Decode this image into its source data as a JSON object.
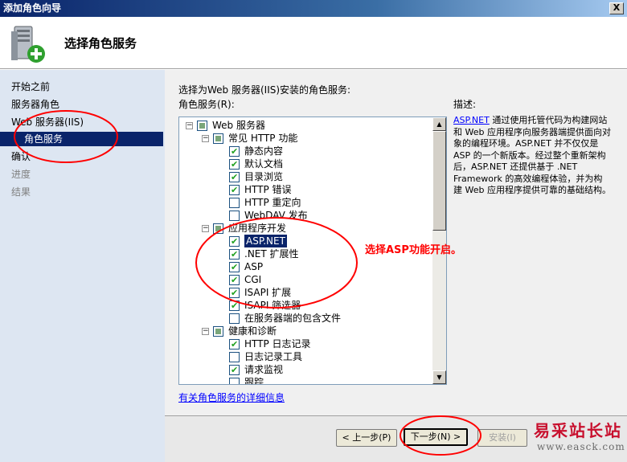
{
  "window": {
    "title": "添加角色向导",
    "close_glyph": "X"
  },
  "header": {
    "heading": "选择角色服务",
    "icon": "server-add-role-icon"
  },
  "sidebar": {
    "items": [
      {
        "label": "开始之前",
        "state": "normal"
      },
      {
        "label": "服务器角色",
        "state": "normal"
      },
      {
        "label": "Web 服务器(IIS)",
        "state": "normal"
      },
      {
        "label": "角色服务",
        "state": "active"
      },
      {
        "label": "确认",
        "state": "normal"
      },
      {
        "label": "进度",
        "state": "disabled"
      },
      {
        "label": "结果",
        "state": "disabled"
      }
    ]
  },
  "main": {
    "instruction": "选择为Web 服务器(IIS)安装的角色服务:",
    "list_label": "角色服务(R):",
    "tree": [
      {
        "label": "Web 服务器",
        "level": 0,
        "expander": "minus",
        "check": "partial"
      },
      {
        "label": "常见 HTTP 功能",
        "level": 1,
        "expander": "minus",
        "check": "partial"
      },
      {
        "label": "静态内容",
        "level": 2,
        "check": "checked"
      },
      {
        "label": "默认文档",
        "level": 2,
        "check": "checked"
      },
      {
        "label": "目录浏览",
        "level": 2,
        "check": "checked"
      },
      {
        "label": "HTTP 错误",
        "level": 2,
        "check": "checked"
      },
      {
        "label": "HTTP 重定向",
        "level": 2,
        "check": "unchecked"
      },
      {
        "label": "WebDAV 发布",
        "level": 2,
        "check": "unchecked"
      },
      {
        "label": "应用程序开发",
        "level": 1,
        "expander": "minus",
        "check": "partial"
      },
      {
        "label": "ASP.NET",
        "level": 2,
        "check": "checked",
        "selected": true
      },
      {
        "label": ".NET 扩展性",
        "level": 2,
        "check": "checked"
      },
      {
        "label": "ASP",
        "level": 2,
        "check": "checked"
      },
      {
        "label": "CGI",
        "level": 2,
        "check": "checked"
      },
      {
        "label": "ISAPI 扩展",
        "level": 2,
        "check": "checked"
      },
      {
        "label": "ISAPI 筛选器",
        "level": 2,
        "check": "checked"
      },
      {
        "label": "在服务器端的包含文件",
        "level": 2,
        "check": "unchecked"
      },
      {
        "label": "健康和诊断",
        "level": 1,
        "expander": "minus",
        "check": "partial"
      },
      {
        "label": "HTTP 日志记录",
        "level": 2,
        "check": "checked"
      },
      {
        "label": "日志记录工具",
        "level": 2,
        "check": "unchecked"
      },
      {
        "label": "请求监视",
        "level": 2,
        "check": "checked"
      },
      {
        "label": "跟踪",
        "level": 2,
        "check": "unchecked"
      }
    ],
    "description": {
      "label": "描述:",
      "link": "ASP.NET",
      "text": "通过使用托管代码为构建网站和 Web 应用程序向服务器端提供面向对象的编程环境。ASP.NET 并不仅仅是 ASP 的一个新版本。经过整个重新架构后，ASP.NET 还提供基于 .NET Framework 的高效编程体验，并为构建 Web 应用程序提供可靠的基础结构。"
    },
    "details_link": "有关角色服务的详细信息"
  },
  "footer": {
    "prev": "< 上一步(P)",
    "next": "下一步(N) >",
    "install": "安装(I)"
  },
  "annotation": {
    "text": "选择ASP功能开启。",
    "color": "#ff0000"
  },
  "watermark": {
    "main": "易采站长站",
    "sub": "www.easck.com"
  },
  "colors": {
    "sidebar_bg": "#dde6f2",
    "selection": "#0a246a",
    "link": "#0000ff",
    "title_gradient_start": "#0a246a"
  }
}
